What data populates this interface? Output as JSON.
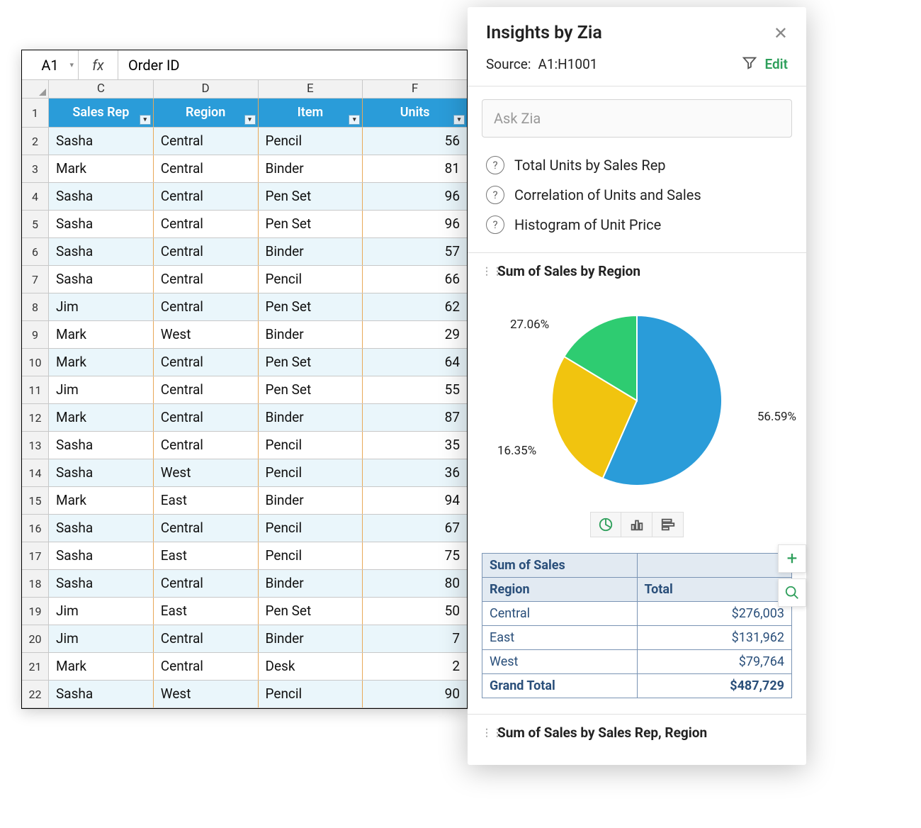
{
  "formula_bar": {
    "cell_ref": "A1",
    "fx": "fx",
    "value": "Order ID"
  },
  "col_letters": [
    "C",
    "D",
    "E",
    "F"
  ],
  "headers": [
    "Sales Rep",
    "Region",
    "Item",
    "Units"
  ],
  "rows": [
    {
      "n": 2,
      "rep": "Sasha",
      "region": "Central",
      "item": "Pencil",
      "units": 56
    },
    {
      "n": 3,
      "rep": "Mark",
      "region": "Central",
      "item": "Binder",
      "units": 81
    },
    {
      "n": 4,
      "rep": "Sasha",
      "region": "Central",
      "item": "Pen Set",
      "units": 96
    },
    {
      "n": 5,
      "rep": "Sasha",
      "region": "Central",
      "item": "Pen Set",
      "units": 96
    },
    {
      "n": 6,
      "rep": "Sasha",
      "region": "Central",
      "item": "Binder",
      "units": 57
    },
    {
      "n": 7,
      "rep": "Sasha",
      "region": "Central",
      "item": "Pencil",
      "units": 66
    },
    {
      "n": 8,
      "rep": "Jim",
      "region": "Central",
      "item": "Pen Set",
      "units": 62
    },
    {
      "n": 9,
      "rep": "Mark",
      "region": "West",
      "item": "Binder",
      "units": 29
    },
    {
      "n": 10,
      "rep": "Mark",
      "region": "Central",
      "item": "Pen Set",
      "units": 64
    },
    {
      "n": 11,
      "rep": "Jim",
      "region": "Central",
      "item": "Pen Set",
      "units": 55
    },
    {
      "n": 12,
      "rep": "Mark",
      "region": "Central",
      "item": "Binder",
      "units": 87
    },
    {
      "n": 13,
      "rep": "Sasha",
      "region": "Central",
      "item": "Pencil",
      "units": 35
    },
    {
      "n": 14,
      "rep": "Sasha",
      "region": "West",
      "item": "Pencil",
      "units": 36
    },
    {
      "n": 15,
      "rep": "Mark",
      "region": "East",
      "item": "Binder",
      "units": 94
    },
    {
      "n": 16,
      "rep": "Sasha",
      "region": "Central",
      "item": "Pencil",
      "units": 67
    },
    {
      "n": 17,
      "rep": "Sasha",
      "region": "East",
      "item": "Pencil",
      "units": 75
    },
    {
      "n": 18,
      "rep": "Sasha",
      "region": "Central",
      "item": "Binder",
      "units": 80
    },
    {
      "n": 19,
      "rep": "Jim",
      "region": "East",
      "item": "Pen Set",
      "units": 50
    },
    {
      "n": 20,
      "rep": "Jim",
      "region": "Central",
      "item": "Binder",
      "units": 7
    },
    {
      "n": 21,
      "rep": "Mark",
      "region": "Central",
      "item": "Desk",
      "units": 2
    },
    {
      "n": 22,
      "rep": "Sasha",
      "region": "West",
      "item": "Pencil",
      "units": 90
    }
  ],
  "panel": {
    "title": "Insights by Zia",
    "source_label": "Source:",
    "source_range": "A1:H1001",
    "edit": "Edit",
    "ask_placeholder": "Ask Zia",
    "suggestions": [
      "Total Units by Sales Rep",
      "Correlation of Units and Sales",
      "Histogram of Unit Price"
    ],
    "section1": "Sum of Sales by Region",
    "section2": "Sum of Sales by Sales Rep, Region"
  },
  "chart_data": {
    "type": "pie",
    "title": "Sum of Sales by Region",
    "slices": [
      {
        "label": "Central",
        "pct": 56.59,
        "color": "#2a9cd9"
      },
      {
        "label": "East",
        "pct": 27.06,
        "color": "#f1c40f"
      },
      {
        "label": "West",
        "pct": 16.35,
        "color": "#2ecc71"
      }
    ]
  },
  "summary": {
    "title": "Sum of Sales",
    "col_region": "Region",
    "col_total": "Total",
    "rows": [
      {
        "region": "Central",
        "total": "$276,003"
      },
      {
        "region": "East",
        "total": "$131,962"
      },
      {
        "region": "West",
        "total": "$79,764"
      }
    ],
    "grand_label": "Grand Total",
    "grand_total": "$487,729"
  }
}
